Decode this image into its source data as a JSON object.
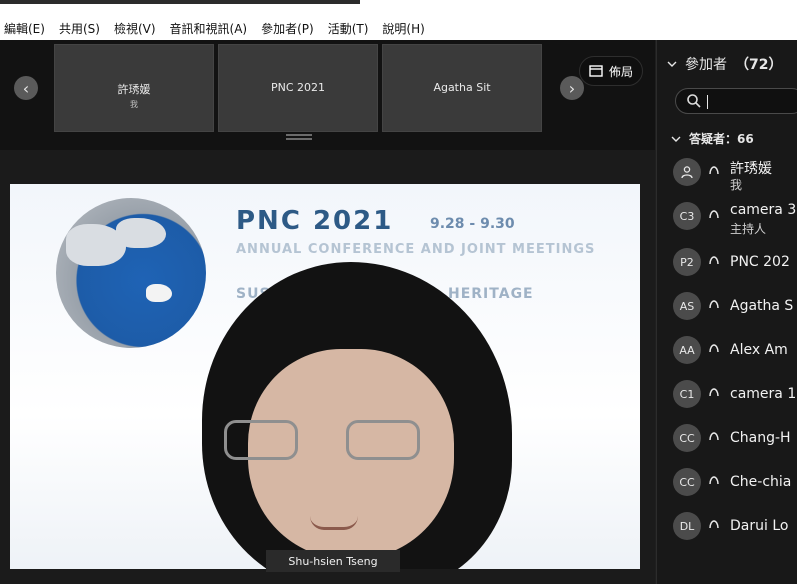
{
  "menu": {
    "items": [
      "編輯(E)",
      "共用(S)",
      "檢視(V)",
      "音訊和視訊(A)",
      "參加者(P)",
      "活動(T)",
      "說明(H)"
    ]
  },
  "strip": {
    "prev_glyph": "‹",
    "next_glyph": "›",
    "thumbs": [
      {
        "name": "許琇媛",
        "sub": "我"
      },
      {
        "name": "PNC 2021",
        "sub": ""
      },
      {
        "name": "Agatha Sit",
        "sub": ""
      }
    ],
    "layout_label": "佈局",
    "layout_icon": "layout-icon"
  },
  "video": {
    "speaker_name": "Shu-hsien Tseng",
    "banner": {
      "title": "PNC 2021",
      "dates": "9.28 - 9.30",
      "subtitle": "ANNUAL CONFERENCE AND JOINT MEETINGS",
      "line2_left": "SUST",
      "line2_right": "HERITAGE"
    }
  },
  "participants": {
    "header_label": "參加者",
    "header_count": "（72）",
    "search_placeholder": "",
    "section_label": "答疑者：66",
    "list": [
      {
        "initials": "",
        "name": "許琇媛",
        "role": "我",
        "avatar_icon": "person-icon"
      },
      {
        "initials": "C3",
        "name": "camera 3",
        "role": "主持人"
      },
      {
        "initials": "P2",
        "name": "PNC 202",
        "role": ""
      },
      {
        "initials": "AS",
        "name": "Agatha S",
        "role": ""
      },
      {
        "initials": "AA",
        "name": "Alex Am",
        "role": ""
      },
      {
        "initials": "C1",
        "name": "camera 1",
        "role": ""
      },
      {
        "initials": "CC",
        "name": "Chang-H",
        "role": ""
      },
      {
        "initials": "CC",
        "name": "Che-chia",
        "role": ""
      },
      {
        "initials": "DL",
        "name": "Darui Lo",
        "role": ""
      }
    ]
  },
  "colors": {
    "background": "#1f1f1f",
    "panel": "#181818",
    "avatar": "#4b4b4b",
    "banner_blue": "#2d5a86"
  }
}
